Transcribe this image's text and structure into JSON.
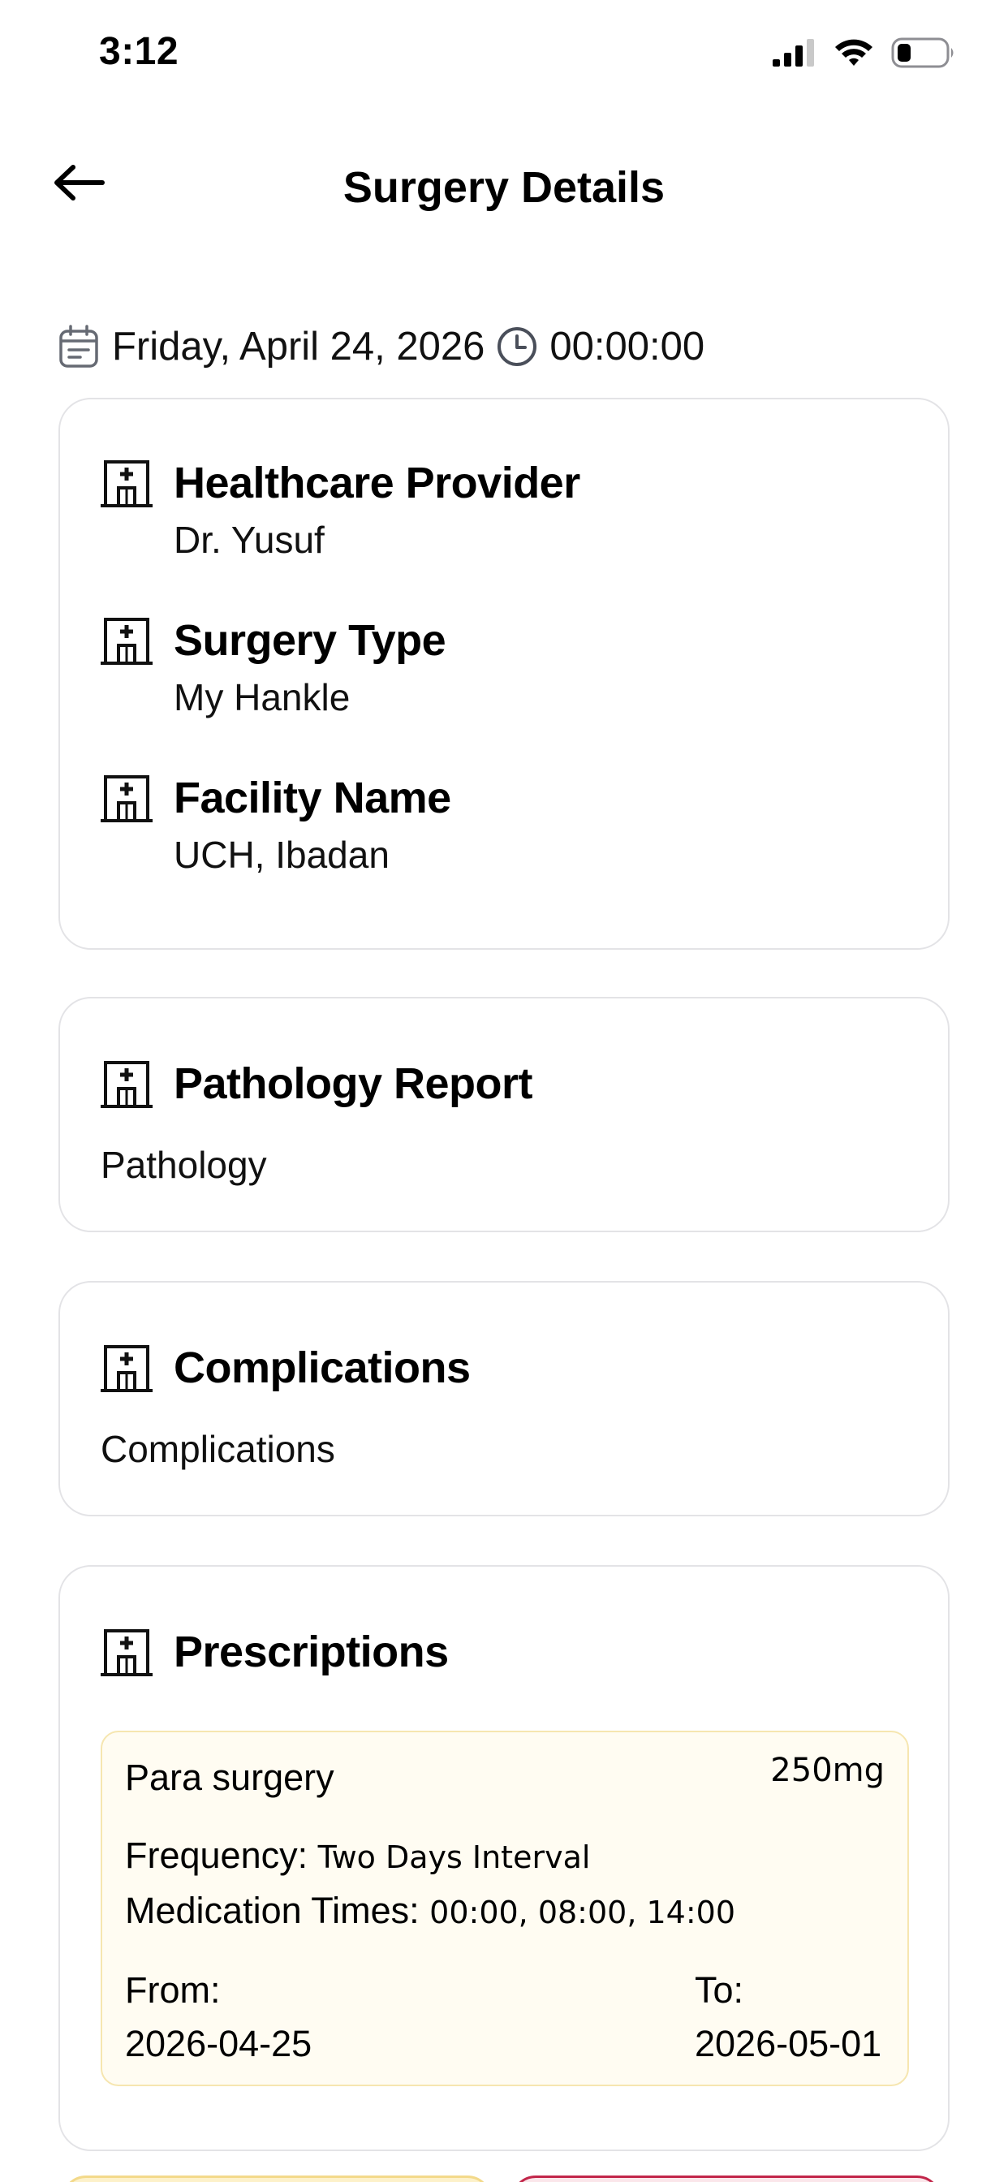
{
  "status_bar": {
    "time": "3:12",
    "icons": [
      "cellular-signal-icon",
      "wifi-icon",
      "battery-icon"
    ]
  },
  "nav": {
    "back_icon": "arrow-left-icon",
    "title": "Surgery Details"
  },
  "schedule": {
    "date": "Friday, April 24, 2026",
    "time": "00:00:00"
  },
  "details": [
    {
      "label": "Healthcare Provider",
      "value": "Dr. Yusuf",
      "icon": "hospital-building-icon"
    },
    {
      "label": "Surgery Type",
      "value": "My Hankle",
      "icon": "hospital-building-icon"
    },
    {
      "label": "Facility Name",
      "value": "UCH, Ibadan",
      "icon": "hospital-building-icon"
    }
  ],
  "pathology": {
    "label": "Pathology Report",
    "value": "Pathology"
  },
  "complications": {
    "label": "Complications",
    "value": "Complications"
  },
  "prescriptions": {
    "label": "Prescriptions",
    "items": [
      {
        "name": "Para surgery",
        "dose": "250mg",
        "frequency_label": "Frequency:",
        "frequency": "Two Days Interval",
        "times_label": "Medication Times:",
        "times": "00:00, 08:00, 14:00",
        "from_label": "From:",
        "from": "2026-04-25",
        "to_label": "To:",
        "to": "2026-05-01"
      }
    ]
  },
  "colors": {
    "card_border": "#e3e3e6",
    "prescription_bg": "#fffcf2",
    "prescription_border": "#f6e6b0",
    "edit_button_bg": "#fdf1c9",
    "delete_button_border": "#c2264a"
  }
}
